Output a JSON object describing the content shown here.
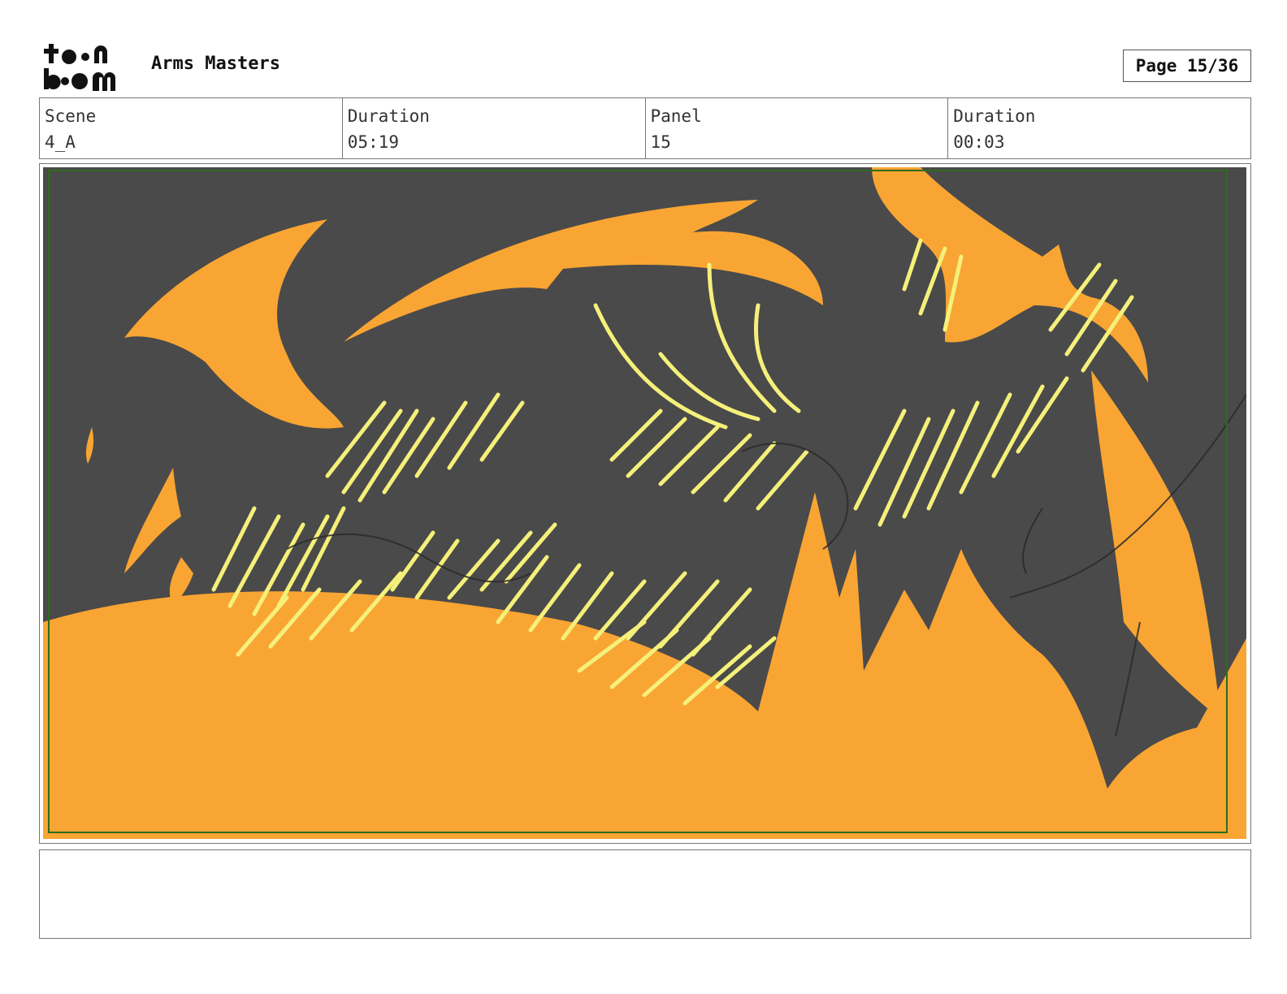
{
  "header": {
    "logo_text_top": "toon",
    "logo_text_bottom": "boom",
    "project_title": "Arms Masters",
    "page_label": "Page 15/36"
  },
  "info": {
    "scene_label": "Scene",
    "scene_value": "4_A",
    "duration_label": "Duration",
    "duration_value": "05:19",
    "panel_label": "Panel",
    "panel_value": "15",
    "panel_duration_label": "Duration",
    "panel_duration_value": "00:03"
  },
  "panel": {
    "colors": {
      "background": "#4a4a4a",
      "flame": "#f9a533",
      "highlight": "#f5f07a",
      "frame_line": "#2e6b1f"
    }
  },
  "notes": {
    "text": ""
  }
}
